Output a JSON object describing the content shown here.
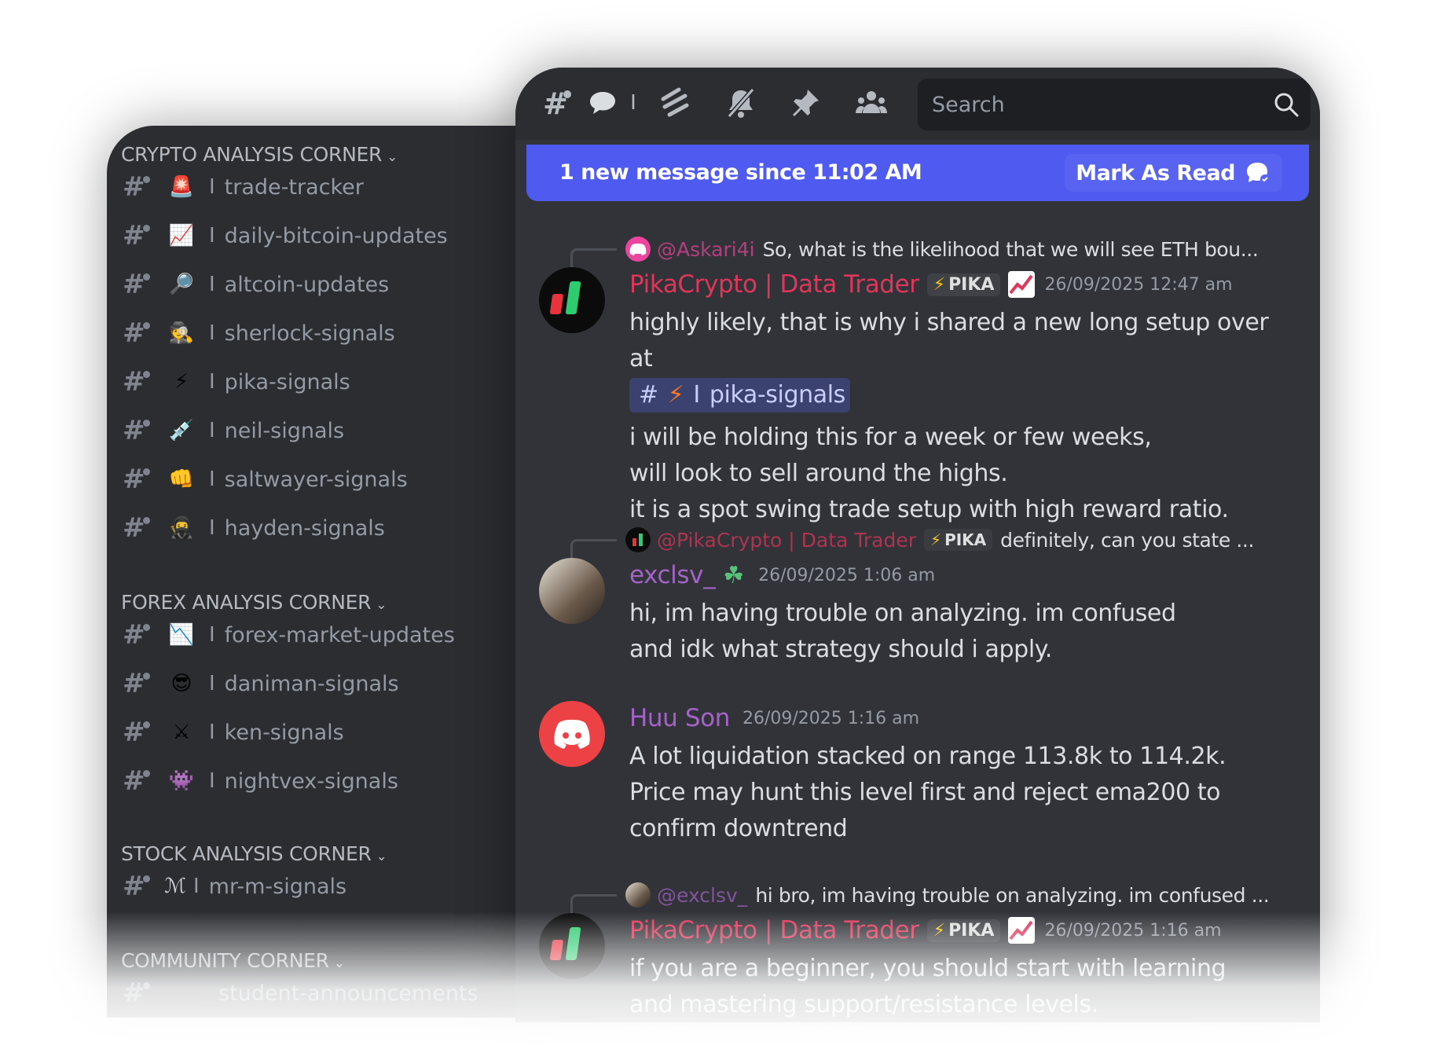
{
  "sidebar": {
    "categories": [
      {
        "label": "CRYPTO ANALYSIS CORNER"
      },
      {
        "label": "FOREX ANALYSIS CORNER"
      },
      {
        "label": "STOCK ANALYSIS CORNER"
      },
      {
        "label": "COMMUNITY CORNER"
      }
    ],
    "channels": [
      {
        "emoji": "🚨",
        "bar": "I",
        "name": "trade-tracker"
      },
      {
        "emoji": "📈",
        "bar": "I",
        "name": "daily-bitcoin-updates"
      },
      {
        "emoji": "🔎",
        "bar": "I",
        "name": "altcoin-updates"
      },
      {
        "emoji": "🕵",
        "bar": "I",
        "name": "sherlock-signals"
      },
      {
        "emoji": "⚡",
        "bar": "I",
        "name": "pika-signals"
      },
      {
        "emoji": "💉",
        "bar": "I",
        "name": "neil-signals"
      },
      {
        "emoji": "👊",
        "bar": "I",
        "name": "saltwayer-signals"
      },
      {
        "emoji": "🥷",
        "bar": "I",
        "name": "hayden-signals"
      },
      {
        "emoji": "📉",
        "bar": "I",
        "name": "forex-market-updates"
      },
      {
        "emoji": "😎",
        "bar": "I",
        "name": "daniman-signals"
      },
      {
        "emoji": "⚔",
        "bar": "I",
        "name": "ken-signals"
      },
      {
        "emoji": "👾",
        "bar": "I",
        "name": "nightvex-signals"
      },
      {
        "emoji": "ℳ",
        "bar": "I",
        "name": "mr-m-signals"
      },
      {
        "emoji": "",
        "bar": "",
        "name": "student-announcements"
      }
    ]
  },
  "toolbar": {
    "search_placeholder": "Search",
    "separator": "I"
  },
  "banner": {
    "text": "1 new message since 11:02 AM",
    "mark_read": "Mark As Read"
  },
  "messages": [
    {
      "reply": {
        "name": "@Askari4i",
        "text": "So, what is the likelihood that we will see ETH bou..."
      },
      "username": "PikaCrypto | Data Trader",
      "tag": "PIKA",
      "time": "26/09/2025 12:47 am",
      "line1": "highly likely, that is why i shared a new long setup over at",
      "mention": {
        "bar": "I",
        "name": "pika-signals"
      },
      "line2": "i will be holding this for a week or few weeks, will look to sell around the highs.",
      "line3": "it is a spot swing trade setup with high reward ratio."
    },
    {
      "reply": {
        "name": "@PikaCrypto | Data Trader",
        "tag": "PIKA",
        "text": "definitely, can you state ..."
      },
      "username": "exclsv_",
      "time": "26/09/2025 1:06 am",
      "line1": "hi, im having trouble on analyzing. im confused and idk what strategy should i apply."
    },
    {
      "username": "Huu Son",
      "time": "26/09/2025 1:16 am",
      "line1": "A lot liquidation stacked on range 113.8k to 114.2k. Price may hunt this level first and reject ema200 to confirm downtrend"
    },
    {
      "reply": {
        "name": "@exclsv_",
        "text": "hi bro, im having trouble on analyzing. im confused ..."
      },
      "username": "PikaCrypto | Data Trader",
      "tag": "PIKA",
      "time": "26/09/2025 1:16 am",
      "line1": "if you are a beginner, you should start with learning and mastering support/resistance levels."
    }
  ],
  "colors": {
    "pika_name": "#e0365a",
    "purple_name": "#a463c8",
    "banner": "#4e5af0",
    "panel": "#313338",
    "sidebar": "#2b2d31"
  },
  "icons": [
    "threads-icon",
    "chat-icon",
    "mute-icon",
    "notification-off-icon",
    "pin-icon",
    "members-icon",
    "search-icon"
  ]
}
